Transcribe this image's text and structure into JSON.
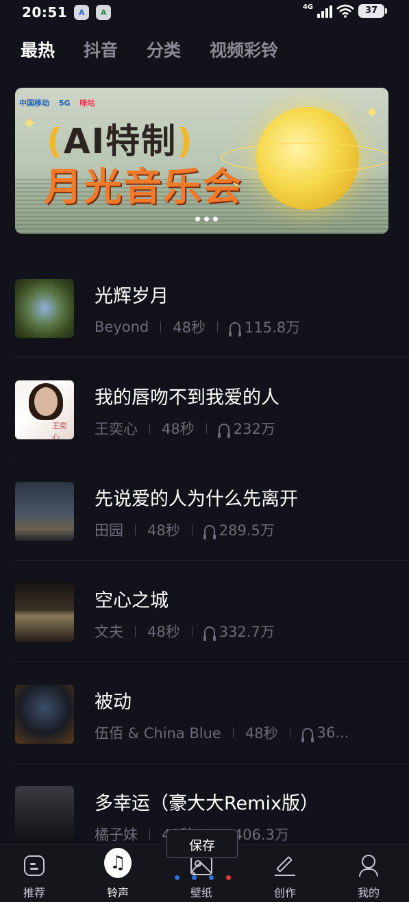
{
  "status_bar": {
    "time": "20:51",
    "app_icons": [
      "A",
      "A"
    ],
    "network": "4G",
    "battery": "37"
  },
  "tabs": [
    {
      "label": "最热",
      "active": true
    },
    {
      "label": "抖音",
      "active": false
    },
    {
      "label": "分类",
      "active": false
    },
    {
      "label": "视频彩铃",
      "active": false
    }
  ],
  "banner": {
    "brand_carrier": "中国移动",
    "brand_5g": "5G",
    "brand_migu": "咪咕",
    "title_line1_open": "(",
    "title_line1": "AI特制",
    "title_line1_close": ")",
    "title_line2": "月光音乐会",
    "page_dots": 3
  },
  "songs": [
    {
      "title": "光辉岁月",
      "artist": "Beyond",
      "duration": "48秒",
      "plays": "115.8万"
    },
    {
      "title": "我的唇吻不到我爱的人",
      "artist": "王奕心",
      "duration": "48秒",
      "plays": "232万",
      "cover_label": "王奕心"
    },
    {
      "title": "先说爱的人为什么先离开",
      "artist": "田园",
      "duration": "48秒",
      "plays": "289.5万"
    },
    {
      "title": "空心之城",
      "artist": "文夫",
      "duration": "48秒",
      "plays": "332.7万"
    },
    {
      "title": "被动",
      "artist": "伍佰 & China Blue",
      "duration": "48秒",
      "plays": "36..."
    },
    {
      "title": "多幸运（豪大大Remix版）",
      "artist": "橘子妹",
      "duration": "48秒",
      "plays": "406.3万"
    }
  ],
  "save_tooltip": "保存",
  "bottom_nav": [
    {
      "label": "推荐",
      "icon": "recommend-icon",
      "active": false
    },
    {
      "label": "铃声",
      "icon": "music-note-icon",
      "active": true
    },
    {
      "label": "壁纸",
      "icon": "wallpaper-icon",
      "active": false
    },
    {
      "label": "创作",
      "icon": "pen-icon",
      "active": false
    },
    {
      "label": "我的",
      "icon": "user-icon",
      "active": false
    }
  ],
  "colors": {
    "background": "#12121a",
    "text_primary": "#ffffff",
    "text_secondary": "#6c6c7a",
    "tab_inactive": "#8a8a96",
    "banner_title_orange": "#f07a2a"
  }
}
